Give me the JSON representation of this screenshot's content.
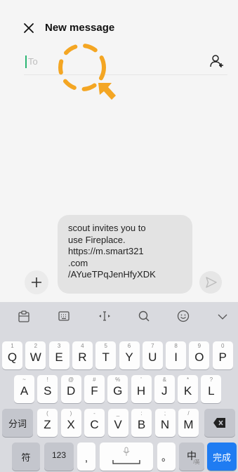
{
  "header": {
    "title": "New message"
  },
  "recipient": {
    "placeholder": "To"
  },
  "compose": {
    "message": "scout invites you to\nuse Fireplace.\nhttps://m.smart321\n.com\n/AYueTPqJenHfyXDK"
  },
  "keyboard": {
    "toolbar_icons": [
      "clipboard-icon",
      "keyboard-layout-icon",
      "cursor-move-icon",
      "search-icon",
      "emoji-icon",
      "collapse-icon"
    ],
    "row1": [
      {
        "main": "Q",
        "sub": "1"
      },
      {
        "main": "W",
        "sub": "2"
      },
      {
        "main": "E",
        "sub": "3"
      },
      {
        "main": "R",
        "sub": "4"
      },
      {
        "main": "T",
        "sub": "5"
      },
      {
        "main": "Y",
        "sub": "6"
      },
      {
        "main": "U",
        "sub": "7"
      },
      {
        "main": "I",
        "sub": "8"
      },
      {
        "main": "O",
        "sub": "9"
      },
      {
        "main": "P",
        "sub": "0"
      }
    ],
    "row2": [
      {
        "main": "A",
        "sub": "~"
      },
      {
        "main": "S",
        "sub": "!"
      },
      {
        "main": "D",
        "sub": "@"
      },
      {
        "main": "F",
        "sub": "#"
      },
      {
        "main": "G",
        "sub": "%"
      },
      {
        "main": "H",
        "sub": "'"
      },
      {
        "main": "J",
        "sub": "&"
      },
      {
        "main": "K",
        "sub": "*"
      },
      {
        "main": "L",
        "sub": "?"
      }
    ],
    "row3": [
      {
        "main": "Z",
        "sub": "("
      },
      {
        "main": "X",
        "sub": ")"
      },
      {
        "main": "C",
        "sub": "-"
      },
      {
        "main": "V",
        "sub": "_"
      },
      {
        "main": "B",
        "sub": ":"
      },
      {
        "main": "N",
        "sub": ";"
      },
      {
        "main": "M",
        "sub": "/"
      }
    ],
    "fenci": "分词",
    "symbols": "符",
    "numbers": "123",
    "comma": ",",
    "period": "。",
    "lang": "中",
    "lang_sub": "/英",
    "done": "完成",
    "done_color": "#1f7cf2"
  }
}
